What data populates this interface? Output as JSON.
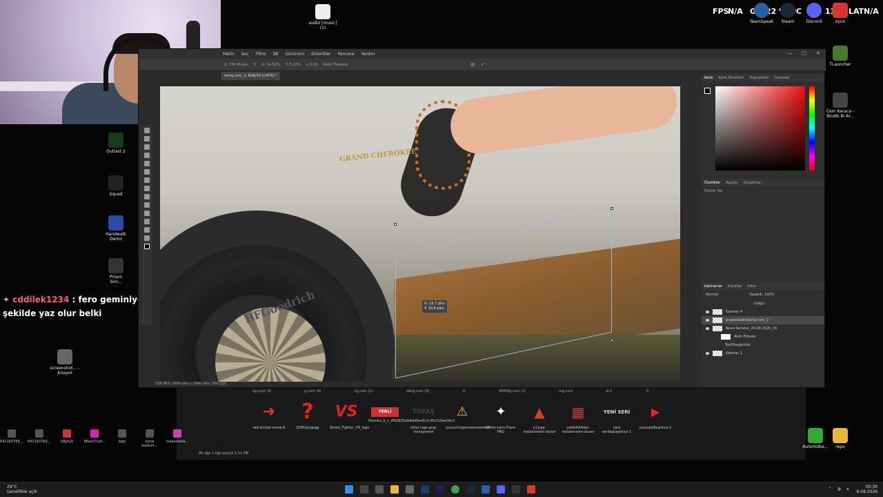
{
  "hud": {
    "fps_label": "FPS",
    "fps_value": "N/A",
    "gpu_label": "GPU",
    "gpu_value": "22 %",
    "pc_label": "PC",
    "discord_count": "13",
    "lat_label": "LAT",
    "lat_value": "N/A",
    "tray_apps": [
      "TeamSpeak",
      "Steam",
      "Discord",
      "oyun"
    ]
  },
  "desktop_top_icon": {
    "label": "audio [music] (1)"
  },
  "desktop_left_icons": [
    {
      "label": "Outlast 2"
    },
    {
      "label": "Squad"
    },
    {
      "label": "Handwalk Demo"
    },
    {
      "label": "Prison Sim..."
    },
    {
      "label": "screenshot... - Kısayol"
    }
  ],
  "desktop_right_icons": [
    {
      "label": "TLauncher"
    },
    {
      "label": "Cem Karaca - Bindik Bi Al..."
    }
  ],
  "chat": {
    "user": "cddilek1234",
    "message": ": fero geminiye aynı şekilde yaz olur belki"
  },
  "photoshop": {
    "menu": [
      "Metin",
      "Seç",
      "Filtre",
      "3B",
      "Görünüm",
      "Eklentiler",
      "Pencere",
      "Yardım"
    ],
    "options": [
      "X: 734.95 pks",
      "Y:",
      "G: 14.52%",
      "Y: 5.22%",
      "∠ 0.00",
      "Kesin Türetme"
    ],
    "doc_tab": "lwing.com_2, RGB/16 (CMYK) *",
    "canvas_text": {
      "emblem": "GRAND CHEROKEE",
      "tire_brand": "BFGoodrich"
    },
    "tooltip": [
      "G: 15.7 piks",
      "Y: 10.6 piks"
    ],
    "status": "526.96%   1600 piks x 1080 piks (300 ppi)",
    "right_tabs": [
      "Renk",
      "Renk Örnekleri",
      "Degradeler",
      "Desenler"
    ],
    "props_tabs": [
      "Özellikler",
      "Ayarlar",
      "Kitaplıklar"
    ],
    "props_label": "Özellik Yok",
    "layer_tabs": [
      "Katmanlar",
      "Kanallar",
      "Yollar"
    ],
    "blend": "Normal",
    "opacity": "Opaklık: 100%",
    "fill": "Dolgu:",
    "layers": [
      {
        "name": "Katman 4",
        "selected": false
      },
      {
        "name": "pngdalalaklitwing.com_2",
        "selected": true
      },
      {
        "name": "Revo-Kariatar_24.08.2026_03",
        "selected": false
      },
      {
        "name": "Akıllı Filtreler",
        "selected": false
      },
      {
        "name": "Ton/Doygunluk",
        "selected": false
      },
      {
        "name": "Katman 1",
        "selected": false
      }
    ],
    "window_buttons": [
      "—",
      "▢",
      "✕"
    ]
  },
  "explorer": {
    "top_labels": [
      "ng.com (3)",
      "g.com (4)",
      "ng.com (1)",
      "ddng.com (3)",
      "m",
      "WWWg.com (2)",
      "ing.com",
      "w-2",
      "-3"
    ],
    "files": [
      {
        "label": "red-sticker-arrow-6",
        "glyph": "➜",
        "color": "#d32"
      },
      {
        "label": "SORUpngegg",
        "glyph": "?",
        "color": "#e21"
      },
      {
        "label": "Street_Fighter_VS_logo",
        "glyph": "VS",
        "color": "#d22"
      },
      {
        "label": "thumbs_b_c_df90825eb9dd5ec6c1c40c52becfdc2",
        "glyph": "YERLİ",
        "color": "#c33"
      },
      {
        "label": "tofas-logo-png-transparent",
        "glyph": "TOFAŞ",
        "color": "#444"
      },
      {
        "label": "ucurumlogomasiesdefault",
        "glyph": "⚠",
        "color": "#ec2"
      },
      {
        "label": "White-Lens-Flare-PNG",
        "glyph": "✦",
        "color": "#fff"
      },
      {
        "label": "y11api-malzemeleri-duvar",
        "glyph": "▲",
        "color": "#c42"
      },
      {
        "label": "yaAAAAAApi-malzemeleri-duvar",
        "glyph": "▦",
        "color": "#b43"
      },
      {
        "label": "yeni serileşbaşlıksız-1",
        "glyph": "YENİ SERİ",
        "color": "#ddd"
      },
      {
        "label": "youtubeBaşlıksız-1",
        "glyph": "▶",
        "color": "#e22"
      }
    ],
    "status": "86 öğe   1 öğe seçildi  5,31 MB"
  },
  "desk_row": [
    {
      "label": "641163769_..."
    },
    {
      "label": "641163769_..."
    },
    {
      "label": "U8pfuU"
    },
    {
      "label": "86ec07cef..."
    },
    {
      "label": "logo"
    },
    {
      "label": "emre bozkurt..."
    },
    {
      "label": "maeesdefa..."
    }
  ],
  "right_bottom": [
    {
      "label": "AutoHotke..."
    },
    {
      "label": "repo"
    }
  ],
  "taskbar": {
    "weather_temp": "29°C",
    "weather_desc": "Genellikle açık",
    "time": "00:30",
    "date": "8.08.2026"
  }
}
